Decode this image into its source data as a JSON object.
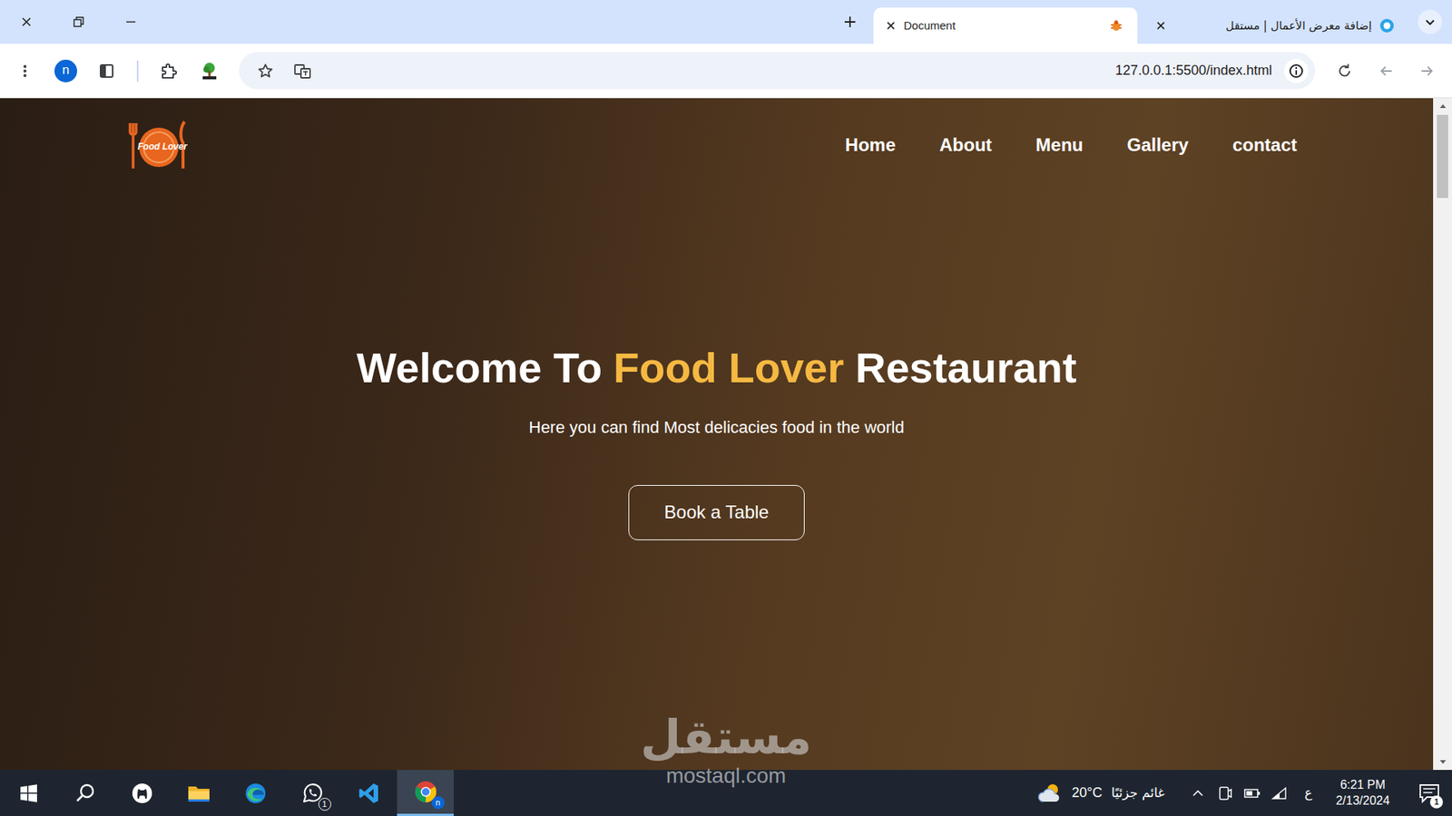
{
  "browser": {
    "tabs": [
      {
        "label": "Document",
        "selected": true
      },
      {
        "label": "إضافة معرض الأعمال | مستقل",
        "selected": false
      }
    ],
    "profile": "n",
    "address": "127.0.0.1:5500/index.html"
  },
  "page": {
    "logo": "Food Lover",
    "nav": [
      "Home",
      "About",
      "Menu",
      "Gallery",
      "contact"
    ],
    "hero": {
      "title": [
        {
          "text": "Welcome To",
          "highlight": false
        },
        {
          "text": "Food Lover",
          "highlight": true
        },
        {
          "text": "Restaurant",
          "highlight": false
        }
      ],
      "subtitle": "Here you can find Most delicacies food in the world",
      "button": "Book a Table"
    },
    "scrollbar": {
      "level": 0.13
    }
  },
  "watermark": {
    "logo": "مستقل",
    "site": "mostaql.com"
  },
  "taskbar": {
    "apps": [
      {
        "kind": "start",
        "active": false
      },
      {
        "kind": "search",
        "active": false
      },
      {
        "kind": "github",
        "active": false
      },
      {
        "kind": "explorer",
        "active": false
      },
      {
        "kind": "edge",
        "active": false
      },
      {
        "kind": "whatsapp",
        "active": false,
        "badge": "1"
      },
      {
        "kind": "vscode",
        "active": false
      },
      {
        "kind": "chrome",
        "active": true,
        "badge": "n"
      }
    ],
    "weather": {
      "temp": "20°C",
      "condition": "غائم جزئيًا"
    },
    "language": "ع",
    "time": "6:21 PM",
    "date": "2/13/2024",
    "notifications": "1"
  }
}
